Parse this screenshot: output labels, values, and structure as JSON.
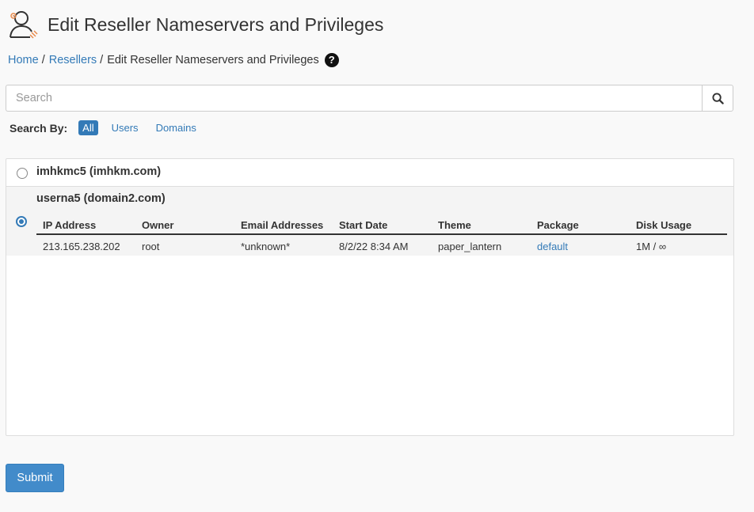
{
  "header": {
    "title": "Edit Reseller Nameservers and Privileges"
  },
  "breadcrumb": {
    "home": "Home",
    "resellers": "Resellers",
    "current": "Edit Reseller Nameservers and Privileges",
    "help": "?"
  },
  "search": {
    "placeholder": "Search",
    "value": ""
  },
  "search_by": {
    "label": "Search By:",
    "options": [
      "All",
      "Users",
      "Domains"
    ],
    "selected": "All"
  },
  "resellers": [
    {
      "name": "imhkmc5 (imhkm.com)",
      "selected": false
    },
    {
      "name": "userna5 (domain2.com)",
      "selected": true,
      "columns": [
        "IP Address",
        "Owner",
        "Email Addresses",
        "Start Date",
        "Theme",
        "Package",
        "Disk Usage"
      ],
      "row": {
        "ip": "213.165.238.202",
        "owner": "root",
        "email": "*unknown*",
        "start_date": "8/2/22 8:34 AM",
        "theme": "paper_lantern",
        "package": "default",
        "disk": "1M / ∞"
      }
    }
  ],
  "submit_label": "Submit",
  "colors": {
    "accent": "#337ab7",
    "button": "#428bca"
  }
}
